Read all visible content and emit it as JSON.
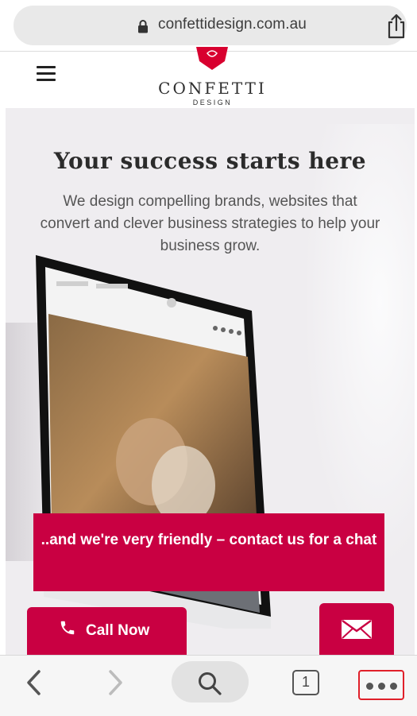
{
  "browser": {
    "url": "confettidesign.com.au",
    "icons": {
      "lock": "lock-icon",
      "share": "share-icon"
    }
  },
  "header": {
    "brand_name": "CONFETTI",
    "brand_sub": "DESIGN",
    "icons": {
      "menu": "hamburger-menu-icon",
      "logo": "confetti-logo-mark"
    }
  },
  "hero": {
    "title": "Your success starts here",
    "subtitle": "We design compelling brands, websites that convert and clever business strategies to help your business grow."
  },
  "cta": {
    "text": "..and we're very friendly – contact us for a chat"
  },
  "floating": {
    "call_label": "Call Now"
  },
  "toolbar": {
    "tab_count": "1",
    "icons": [
      "back-arrow-icon",
      "forward-arrow-icon",
      "search-icon",
      "tabs-icon",
      "more-icon"
    ]
  },
  "colors": {
    "brand_red": "#c90042",
    "hero_bg": "#efedf0",
    "highlight_border": "#e0202a"
  }
}
